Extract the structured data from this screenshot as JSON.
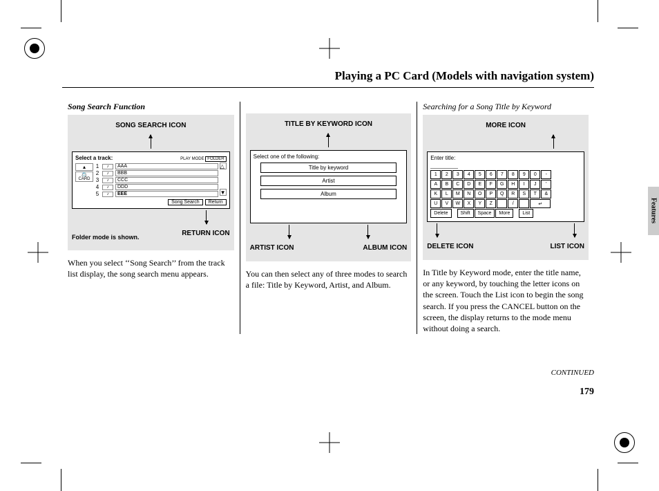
{
  "page": {
    "title": "Playing a PC Card (Models with navigation system)",
    "side_tab": "Features",
    "continued": "CONTINUED",
    "page_number": "179"
  },
  "col1": {
    "heading": "Song Search Function",
    "top_label": "SONG SEARCH ICON",
    "screen_title": "Select a track:",
    "play_mode": "PLAY MODE",
    "play_mode_val": "FOLDER",
    "card_label": "CARD",
    "tracks": [
      "AAA",
      "BBB",
      "CCC",
      "DDD",
      "EEE"
    ],
    "btn_search": "Song Search",
    "btn_return": "Return",
    "folder_note": "Folder mode is shown.",
    "return_label": "RETURN ICON",
    "body": "When you select ‘‘Song Search’’ from the track list display, the song search menu appears."
  },
  "col2": {
    "top_label": "TITLE BY KEYWORD ICON",
    "screen_title": "Select one of the following:",
    "opt1": "Title by keyword",
    "opt2": "Artist",
    "opt3": "Album",
    "artist_label": "ARTIST ICON",
    "album_label": "ALBUM ICON",
    "body": "You can then select any of three modes to search a file: Title by Keyword, Artist, and Album."
  },
  "col3": {
    "heading": "Searching for a Song Title by Keyword",
    "top_label": "MORE ICON",
    "screen_title": "Enter title:",
    "row1": [
      "1",
      "2",
      "3",
      "4",
      "5",
      "6",
      "7",
      "8",
      "9",
      "0",
      "-"
    ],
    "row2": [
      "A",
      "B",
      "C",
      "D",
      "E",
      "F",
      "G",
      "H",
      "I",
      "J",
      "'"
    ],
    "row3": [
      "K",
      "L",
      "M",
      "N",
      "O",
      "P",
      "Q",
      "R",
      "S",
      "T",
      "&"
    ],
    "row4": [
      "U",
      "V",
      "W",
      "X",
      "Y",
      "Z",
      "",
      "/",
      "",
      "",
      ""
    ],
    "btn_delete": "Delete",
    "btn_shift": "Shift",
    "btn_space": "Space",
    "btn_more": "More",
    "btn_list": "List",
    "delete_label": "DELETE ICON",
    "list_label": "LIST ICON",
    "body": "In Title by Keyword mode, enter the title name, or any keyword, by touching the letter icons on the screen. Touch the List icon to begin the song search. If you press the CANCEL button on the screen, the display returns to the mode menu without doing a search."
  }
}
